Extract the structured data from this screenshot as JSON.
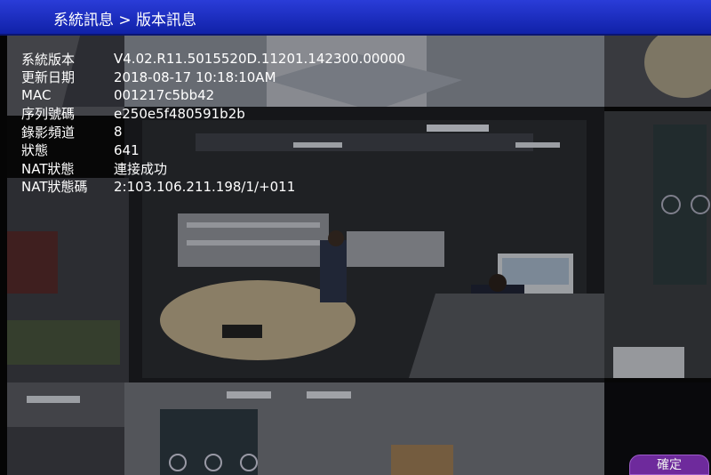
{
  "header": {
    "breadcrumb": "系統訊息 > 版本訊息"
  },
  "info_rows": [
    {
      "label": "系統版本",
      "value": "V4.02.R11.5015520D.11201.142300.00000"
    },
    {
      "label": "更新日期",
      "value": "2018-08-17 10:18:10AM"
    },
    {
      "label": "MAC",
      "value": "001217c5bb42"
    },
    {
      "label": "序列號碼",
      "value": "e250e5f480591b2b"
    },
    {
      "label": "錄影頻道",
      "value": "8"
    },
    {
      "label": "狀態",
      "value": "641"
    },
    {
      "label": "NAT狀態",
      "value": "連接成功"
    },
    {
      "label": "NAT狀態碼",
      "value": "2:103.106.211.198/1/+011"
    }
  ],
  "footer": {
    "confirm_label": "確定"
  },
  "colors": {
    "title_bar": "#1a2cc6",
    "confirm_button": "#6e2a9c"
  },
  "background": {
    "description_icon": "camera-feed-collage"
  }
}
